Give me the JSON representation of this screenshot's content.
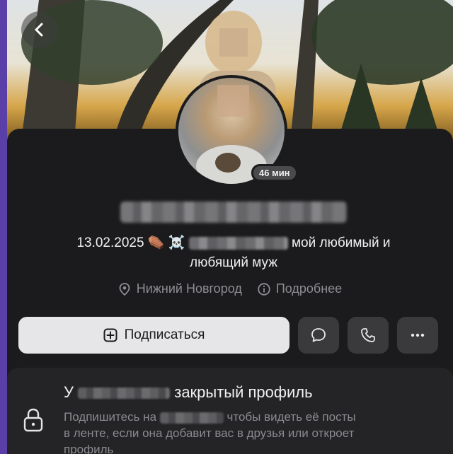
{
  "profile": {
    "online_badge": "46 мин",
    "status_date": "13.02.2025",
    "status_emojis": "⚰️ ☠️",
    "status_text_1": "мой любимый и",
    "status_text_2": "любящий муж",
    "city": "Нижний Новгород",
    "details_label": "Подробнее"
  },
  "actions": {
    "subscribe_label": "Подписаться"
  },
  "closed_profile": {
    "title_prefix": "У",
    "title_suffix": "закрытый профиль",
    "desc_1_prefix": "Подпишитесь на",
    "desc_1_suffix": "чтобы видеть её посты",
    "desc_2": "в ленте, если она добавит вас в друзья или откроет",
    "desc_3": "профиль"
  }
}
